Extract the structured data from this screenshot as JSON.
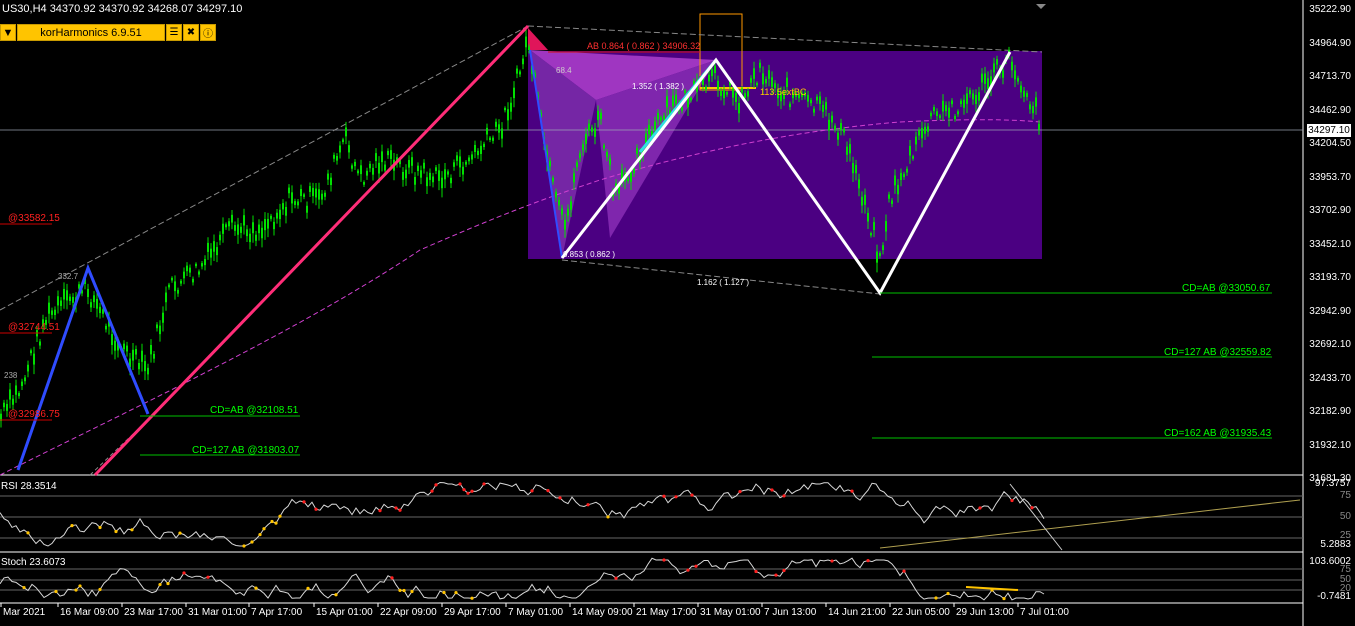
{
  "header": {
    "symbol_line": "US30,H4  34370.92 34370.92 34268.07 34297.10"
  },
  "toolbar": {
    "indicator_name": "korHarmonics 6.9.51",
    "arrow_glyph": "▼",
    "icons": [
      "sliders-icon",
      "tools-icon",
      "info-icon"
    ]
  },
  "price_axis": {
    "labels": [
      "35222.90",
      "34964.90",
      "34713.70",
      "34462.90",
      "34204.50",
      "33953.70",
      "33702.90",
      "33452.10",
      "33193.70",
      "32942.90",
      "32692.10",
      "32433.70",
      "32182.90",
      "31932.10",
      "31681.30"
    ],
    "current_price": "34297.10"
  },
  "time_axis": {
    "labels": [
      "Mar 2021",
      "16 Mar 09:00",
      "23 Mar 17:00",
      "31 Mar 01:00",
      "7 Apr 17:00",
      "15 Apr 01:00",
      "22 Apr 09:00",
      "29 Apr 17:00",
      "7 May 01:00",
      "14 May 09:00",
      "21 May 17:00",
      "31 May 01:00",
      "7 Jun 13:00",
      "14 Jun 21:00",
      "22 Jun 05:00",
      "29 Jun 13:00",
      "7 Jul 01:00"
    ]
  },
  "annotations": {
    "left_levels": [
      "@33582.15",
      "@32744.51",
      "@32986.75"
    ],
    "left_small": [
      "332.7",
      "238"
    ],
    "cd_ab_left": "CD=AB   @32108.51",
    "cd_127_left": "CD=127 AB   @31803.07",
    "ab_top": "AB 0.864 ( 0.862 ) 34906.32",
    "ratio_1352": "1.352 ( 1.382 )",
    "ratio_0853": "0.853 ( 0.862 )",
    "ratio_1162": "1.162 ( 1.127 )",
    "label_1131": "113.5extBC",
    "label_684": "68.4",
    "cd_ab_right": "CD=AB   @33050.67",
    "cd_127_right": "CD=127 AB   @32559.82",
    "cd_162_right": "CD=162 AB   @31935.43"
  },
  "rsi_panel": {
    "title": "RSI 28.3514",
    "axis": [
      "97.3757",
      "75",
      "50",
      "25",
      "5.2883"
    ]
  },
  "stoch_panel": {
    "title": "Stoch 23.6073",
    "axis": [
      "103.6002",
      "75",
      "50",
      "20",
      "-0.7481"
    ]
  },
  "colors": {
    "candle": "#00e000",
    "pattern_fill": "#4b0082",
    "pattern_inner": "#b040d0",
    "pink_trend": "#ff2d78",
    "blue_leg": "#2f4cff",
    "zigzag": "#ffffff",
    "level_line": "#00c000",
    "level_text": "#00ff00",
    "red_text": "#ff2020",
    "yellow": "#ffc400"
  }
}
